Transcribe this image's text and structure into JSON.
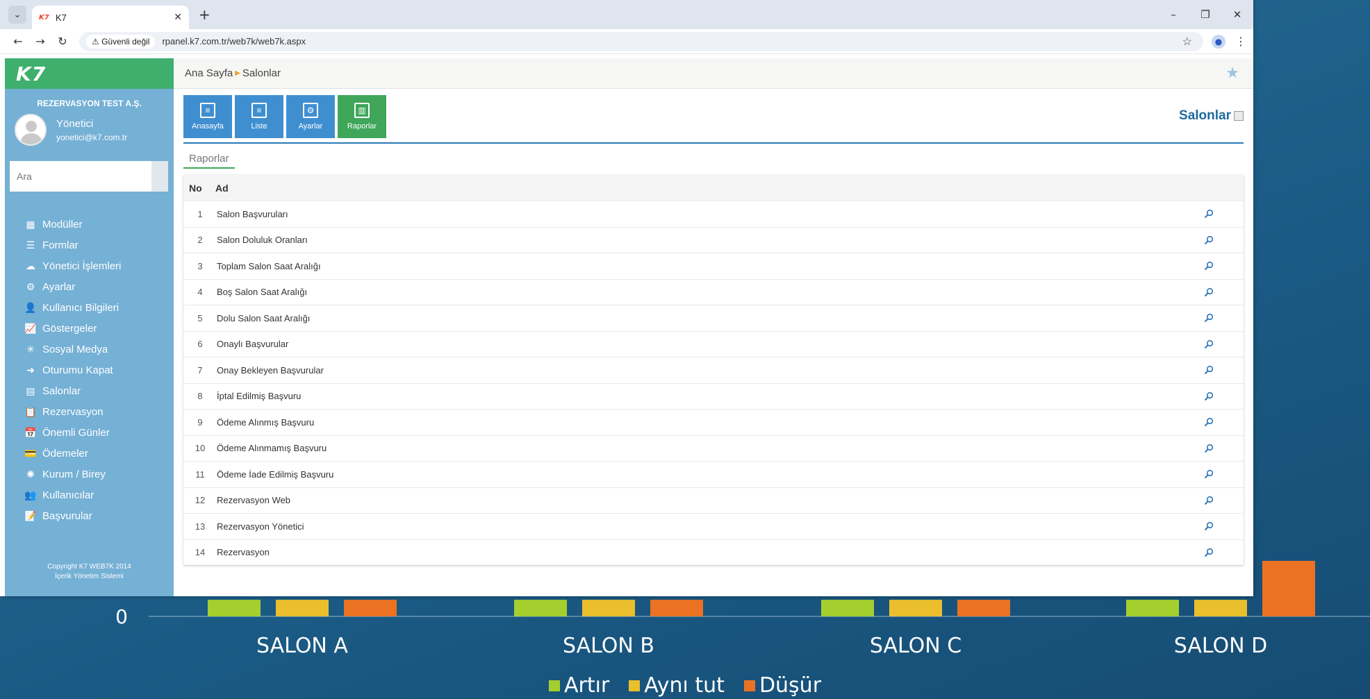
{
  "background_chart": {
    "zero_label": "0",
    "categories": [
      "SALON A",
      "SALON B",
      "SALON C",
      "SALON D"
    ],
    "legend": [
      {
        "label": "Artır",
        "color": "#a4cf2e"
      },
      {
        "label": "Aynı tut",
        "color": "#e9bf2e"
      },
      {
        "label": "Düşür",
        "color": "#ea7222"
      }
    ]
  },
  "chart_data": {
    "type": "bar",
    "categories": [
      "SALON A",
      "SALON B",
      "SALON C",
      "SALON D"
    ],
    "series": [
      {
        "name": "Artır",
        "values": [
          0.3,
          0.3,
          0.3,
          0.3
        ]
      },
      {
        "name": "Aynı tut",
        "values": [
          0.3,
          0.3,
          0.3,
          0.3
        ]
      },
      {
        "name": "Düşür",
        "values": [
          0.3,
          0.3,
          0.3,
          1.0
        ]
      }
    ],
    "ylim": [
      0,
      3
    ],
    "tick_labels": [
      "0"
    ],
    "legend_position": "bottom",
    "colors": {
      "Artır": "#a4cf2e",
      "Aynı tut": "#e9bf2e",
      "Düşür": "#ea7222"
    }
  },
  "browser": {
    "tab_title": "K7",
    "tab_favicon": "K7",
    "address_security": "Güvenli değil",
    "url": "rpanel.k7.com.tr/web7k/web7k.aspx"
  },
  "sidebar": {
    "logo": "K7",
    "company": "REZERVASYON TEST A.Ş.",
    "user_name": "Yönetici",
    "user_email": "yonetici@k7.com.tr",
    "search_placeholder": "Ara",
    "menu": [
      {
        "label": "Modüller",
        "icon": "grid-icon",
        "glyph": "▦"
      },
      {
        "label": "Formlar",
        "icon": "list-icon",
        "glyph": "☰"
      },
      {
        "label": "Yönetici İşlemleri",
        "icon": "cloud-icon",
        "glyph": "☁"
      },
      {
        "label": "Ayarlar",
        "icon": "gear-icon",
        "glyph": "⚙"
      },
      {
        "label": "Kullanıcı Bilgileri",
        "icon": "user-icon",
        "glyph": "👤"
      },
      {
        "label": "Göstergeler",
        "icon": "chart-icon",
        "glyph": "📈"
      },
      {
        "label": "Sosyal Medya",
        "icon": "network-icon",
        "glyph": "✳"
      },
      {
        "label": "Oturumu Kapat",
        "icon": "logout-icon",
        "glyph": "➜"
      },
      {
        "label": "Salonlar",
        "icon": "building-icon",
        "glyph": "▤"
      },
      {
        "label": "Rezervasyon",
        "icon": "clipboard-icon",
        "glyph": "📋"
      },
      {
        "label": "Önemli Günler",
        "icon": "calendar-icon",
        "glyph": "📅"
      },
      {
        "label": "Ödemeler",
        "icon": "wallet-icon",
        "glyph": "💳"
      },
      {
        "label": "Kurum / Birey",
        "icon": "bug-icon",
        "glyph": "✺"
      },
      {
        "label": "Kullanıcılar",
        "icon": "users-icon",
        "glyph": "👥"
      },
      {
        "label": "Başvurular",
        "icon": "document-icon",
        "glyph": "📝"
      }
    ],
    "copyright_line1": "Copyright K7 WEB7K 2014",
    "copyright_line2": "İçerik Yönetim Sistemi"
  },
  "main": {
    "breadcrumb_home": "Ana Sayfa",
    "breadcrumb_current": "Salonlar",
    "actions": [
      {
        "label": "Anasayfa",
        "icon": "list-icon",
        "glyph": "≡",
        "active": false
      },
      {
        "label": "Liste",
        "icon": "list-icon",
        "glyph": "≡",
        "active": false
      },
      {
        "label": "Ayarlar",
        "icon": "gears-icon",
        "glyph": "⚙",
        "active": false
      },
      {
        "label": "Raporlar",
        "icon": "report-icon",
        "glyph": "▥",
        "active": true
      }
    ],
    "page_title": "Salonlar",
    "subtab": "Raporlar",
    "table": {
      "headers": {
        "no": "No",
        "ad": "Ad"
      },
      "rows": [
        {
          "no": "1",
          "ad": "Salon Başvuruları"
        },
        {
          "no": "2",
          "ad": "Salon Doluluk Oranları"
        },
        {
          "no": "3",
          "ad": "Toplam Salon Saat Aralığı"
        },
        {
          "no": "4",
          "ad": "Boş Salon Saat Aralığı"
        },
        {
          "no": "5",
          "ad": "Dolu Salon Saat Aralığı"
        },
        {
          "no": "6",
          "ad": "Onaylı Başvurular"
        },
        {
          "no": "7",
          "ad": "Onay Bekleyen Başvurular"
        },
        {
          "no": "8",
          "ad": "İptal Edilmiş Başvuru"
        },
        {
          "no": "9",
          "ad": "Ödeme Alınmış Başvuru"
        },
        {
          "no": "10",
          "ad": "Ödeme Alınmamış Başvuru"
        },
        {
          "no": "11",
          "ad": "Ödeme İade Edilmiş Başvuru"
        },
        {
          "no": "12",
          "ad": "Rezervasyon Web"
        },
        {
          "no": "13",
          "ad": "Rezervasyon Yönetici"
        },
        {
          "no": "14",
          "ad": "Rezervasyon"
        }
      ]
    }
  }
}
